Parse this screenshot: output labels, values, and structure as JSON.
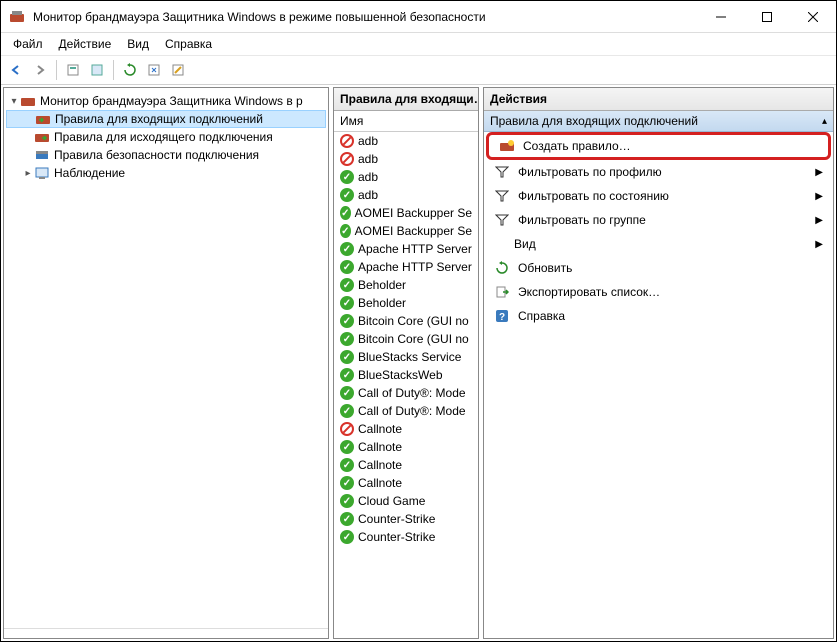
{
  "window": {
    "title": "Монитор брандмауэра Защитника Windows в режиме повышенной безопасности"
  },
  "menubar": {
    "file": "Файл",
    "action": "Действие",
    "view": "Вид",
    "help": "Справка"
  },
  "tree": {
    "root": "Монитор брандмауэра Защитника Windows в р",
    "items": [
      "Правила для входящих подключений",
      "Правила для исходящего подключения",
      "Правила безопасности подключения",
      "Наблюдение"
    ]
  },
  "rules_panel": {
    "header": "Правила для входящи…",
    "col_name": "Имя",
    "rows": [
      {
        "status": "block",
        "name": "adb"
      },
      {
        "status": "block",
        "name": "adb"
      },
      {
        "status": "allow",
        "name": "adb"
      },
      {
        "status": "allow",
        "name": "adb"
      },
      {
        "status": "allow",
        "name": "AOMEI Backupper Se"
      },
      {
        "status": "allow",
        "name": "AOMEI Backupper Se"
      },
      {
        "status": "allow",
        "name": "Apache HTTP Server"
      },
      {
        "status": "allow",
        "name": "Apache HTTP Server"
      },
      {
        "status": "allow",
        "name": "Beholder"
      },
      {
        "status": "allow",
        "name": "Beholder"
      },
      {
        "status": "allow",
        "name": "Bitcoin Core (GUI no"
      },
      {
        "status": "allow",
        "name": "Bitcoin Core (GUI no"
      },
      {
        "status": "allow",
        "name": "BlueStacks Service"
      },
      {
        "status": "allow",
        "name": "BlueStacksWeb"
      },
      {
        "status": "allow",
        "name": "Call of Duty®: Mode"
      },
      {
        "status": "allow",
        "name": "Call of Duty®: Mode"
      },
      {
        "status": "block",
        "name": "Callnote"
      },
      {
        "status": "allow",
        "name": "Callnote"
      },
      {
        "status": "allow",
        "name": "Callnote"
      },
      {
        "status": "allow",
        "name": "Callnote"
      },
      {
        "status": "allow",
        "name": "Cloud Game"
      },
      {
        "status": "allow",
        "name": "Counter-Strike"
      },
      {
        "status": "allow",
        "name": "Counter-Strike"
      }
    ]
  },
  "actions_panel": {
    "header": "Действия",
    "section": "Правила для входящих подключений",
    "items": {
      "new_rule": "Создать правило…",
      "filter_profile": "Фильтровать по профилю",
      "filter_state": "Фильтровать по состоянию",
      "filter_group": "Фильтровать по группе",
      "view": "Вид",
      "refresh": "Обновить",
      "export": "Экспортировать список…",
      "help": "Справка"
    }
  }
}
